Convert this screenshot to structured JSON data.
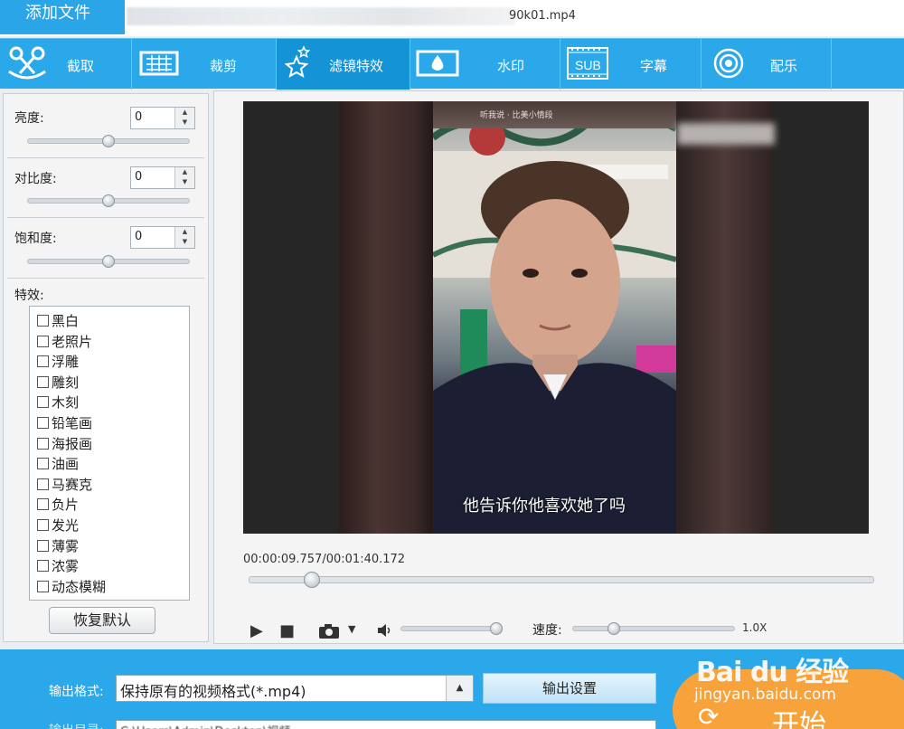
{
  "topbar": {
    "add_file_label": "添加文件",
    "file_name_visible": "90k01.mp4"
  },
  "toolbar": {
    "tools": [
      {
        "label": "截取",
        "icon": "scissors-icon"
      },
      {
        "label": "裁剪",
        "icon": "crop-frame-icon"
      },
      {
        "label": "滤镜特效",
        "icon": "stars-icon",
        "active": true
      },
      {
        "label": "水印",
        "icon": "water-drop-icon"
      },
      {
        "label": "字幕",
        "icon": "subtitle-sub-icon",
        "icon_text": "SUB"
      },
      {
        "label": "配乐",
        "icon": "audio-waves-icon"
      }
    ]
  },
  "adjust": {
    "brightness": {
      "label": "亮度:",
      "value": "0",
      "slider_fraction": 0.5
    },
    "contrast": {
      "label": "对比度:",
      "value": "0",
      "slider_fraction": 0.5
    },
    "saturation": {
      "label": "饱和度:",
      "value": "0",
      "slider_fraction": 0.5
    }
  },
  "effects": {
    "label": "特效:",
    "items": [
      "黑白",
      "老照片",
      "浮雕",
      "雕刻",
      "木刻",
      "铅笔画",
      "海报画",
      "油画",
      "马赛克",
      "负片",
      "发光",
      "薄雾",
      "浓雾",
      "动态模糊"
    ],
    "reset_label": "恢复默认"
  },
  "player": {
    "overlay_top_text": "听我说 · 比美小情段",
    "subtitle": "他告诉你他喜欢她了吗",
    "current_time": "00:00:09.757",
    "separator": "/",
    "total_time": "00:01:40.172",
    "seek_fraction": 0.1,
    "volume_fraction": 0.95,
    "speed_label": "速度:",
    "speed_value": "1.0X",
    "speed_fraction": 0.25
  },
  "output": {
    "format_label": "输出格式:",
    "format_value": "保持原有的视频格式(*.mp4)",
    "settings_label": "输出设置",
    "dir_label": "输出目录:",
    "dir_value": "C:\\Users\\Admin\\Desktop\\视频",
    "start_label": "开始"
  },
  "watermark": {
    "logo_text": "Bai du 经验",
    "url": "jingyan.baidu.com"
  },
  "colors": {
    "accent": "#2aa8ea",
    "toolbar_active": "#1493d7",
    "start_button": "#f7a23a"
  }
}
